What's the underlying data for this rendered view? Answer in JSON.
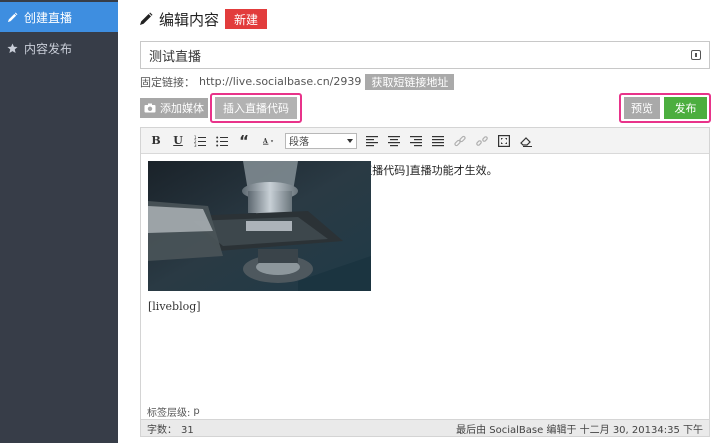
{
  "sidebar": {
    "items": [
      {
        "label": "创建直播",
        "icon": "pencil-icon",
        "active": true
      },
      {
        "label": "内容发布",
        "icon": "star-icon",
        "active": false
      }
    ]
  },
  "header": {
    "title": "编辑内容",
    "new_button": "新建"
  },
  "post": {
    "title_value": "测试直播",
    "permalink_label": "固定链接：",
    "permalink_url": "http://live.socialbase.cn/2939",
    "short_link_button": "获取短链接地址"
  },
  "actions": {
    "add_media": "添加媒体",
    "insert_live_code": "插入直播代码",
    "preview": "预览",
    "publish": "发布"
  },
  "toolbar": {
    "bold": "B",
    "underline": "U",
    "format_select": "段落",
    "quote": "“"
  },
  "editor": {
    "body_text": "这里放置一些直播的说明。记得要点击[插入直播代码]直播功能才生效。",
    "shortcode": "[liveblog]",
    "tag_path_label": "标签层级:",
    "tag_path_value": "p",
    "word_count_label": "字数：",
    "word_count": "31",
    "last_edited": "最后由 SocialBase 编辑于 十二月 30, 20134:35 下午"
  },
  "colors": {
    "sidebar_bg": "#373d48",
    "sidebar_active": "#3e8ee0",
    "new_button": "#e23c3c",
    "publish_button": "#4cae3f",
    "highlight": "#e8338a"
  }
}
